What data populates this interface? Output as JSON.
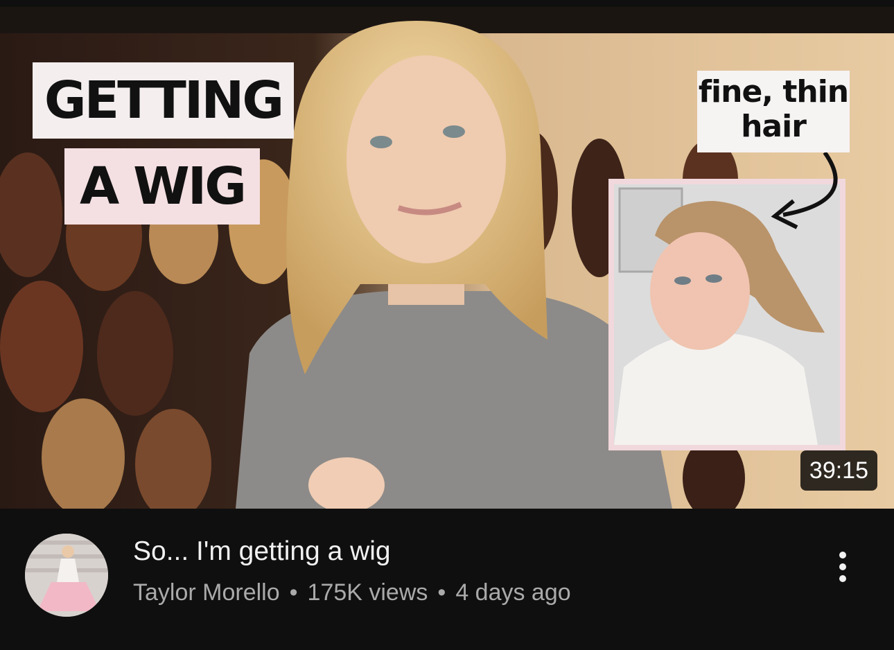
{
  "thumbnail": {
    "overlay_line_1": "GETTING",
    "overlay_line_2": "A WIG",
    "callout_line_1": "fine, thin",
    "callout_line_2": "hair",
    "duration": "39:15"
  },
  "video": {
    "title": "So... I'm getting a wig",
    "channel": "Taylor Morello",
    "separator": "•",
    "views": "175K views",
    "age": "4 days ago"
  },
  "colors": {
    "background": "#0f0f0f",
    "title_text": "#f1f1f1",
    "meta_text": "#aaaaaa",
    "badge_bg": "#000000"
  },
  "icons": {
    "more": "vertical-ellipsis-icon"
  }
}
